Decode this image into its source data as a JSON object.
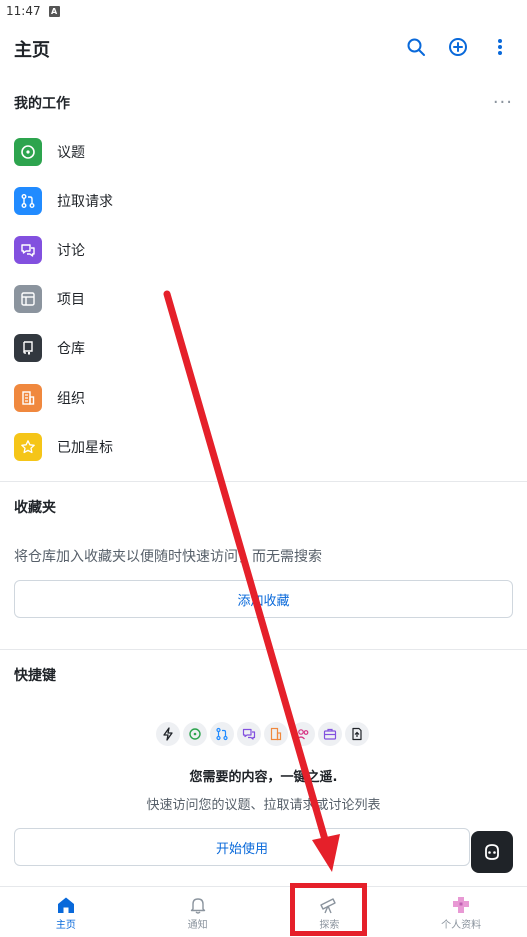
{
  "status_bar": {
    "time": "11:47",
    "indicator": "A"
  },
  "header": {
    "title": "主页"
  },
  "my_work": {
    "title": "我的工作",
    "more": "···",
    "items": [
      {
        "label": "议题",
        "icon": "issue-icon",
        "color": "#2da44e"
      },
      {
        "label": "拉取请求",
        "icon": "pull-request-icon",
        "color": "#218bff"
      },
      {
        "label": "讨论",
        "icon": "discussion-icon",
        "color": "#8250df"
      },
      {
        "label": "项目",
        "icon": "project-icon",
        "color": "#8b949e"
      },
      {
        "label": "仓库",
        "icon": "repo-icon",
        "color": "#32383f"
      },
      {
        "label": "组织",
        "icon": "organization-icon",
        "color": "#f0883e"
      },
      {
        "label": "已加星标",
        "icon": "star-icon",
        "color": "#f5c518"
      }
    ]
  },
  "favorites": {
    "title": "收藏夹",
    "description": "将仓库加入收藏夹以便随时快速访问，而无需搜索",
    "button": "添加收藏"
  },
  "shortcuts": {
    "title": "快捷键",
    "heading": "您需要的内容，一键之遥.",
    "description": "快速访问您的议题、拉取请求或讨论列表",
    "button": "开始使用"
  },
  "bottom_nav": [
    {
      "label": "主页",
      "icon": "home-icon",
      "active": true
    },
    {
      "label": "通知",
      "icon": "bell-icon",
      "active": false
    },
    {
      "label": "探索",
      "icon": "telescope-icon",
      "active": false
    },
    {
      "label": "个人资料",
      "icon": "avatar-icon",
      "active": false
    }
  ],
  "colors": {
    "accent": "#0969da",
    "annotation": "#e5202a"
  }
}
